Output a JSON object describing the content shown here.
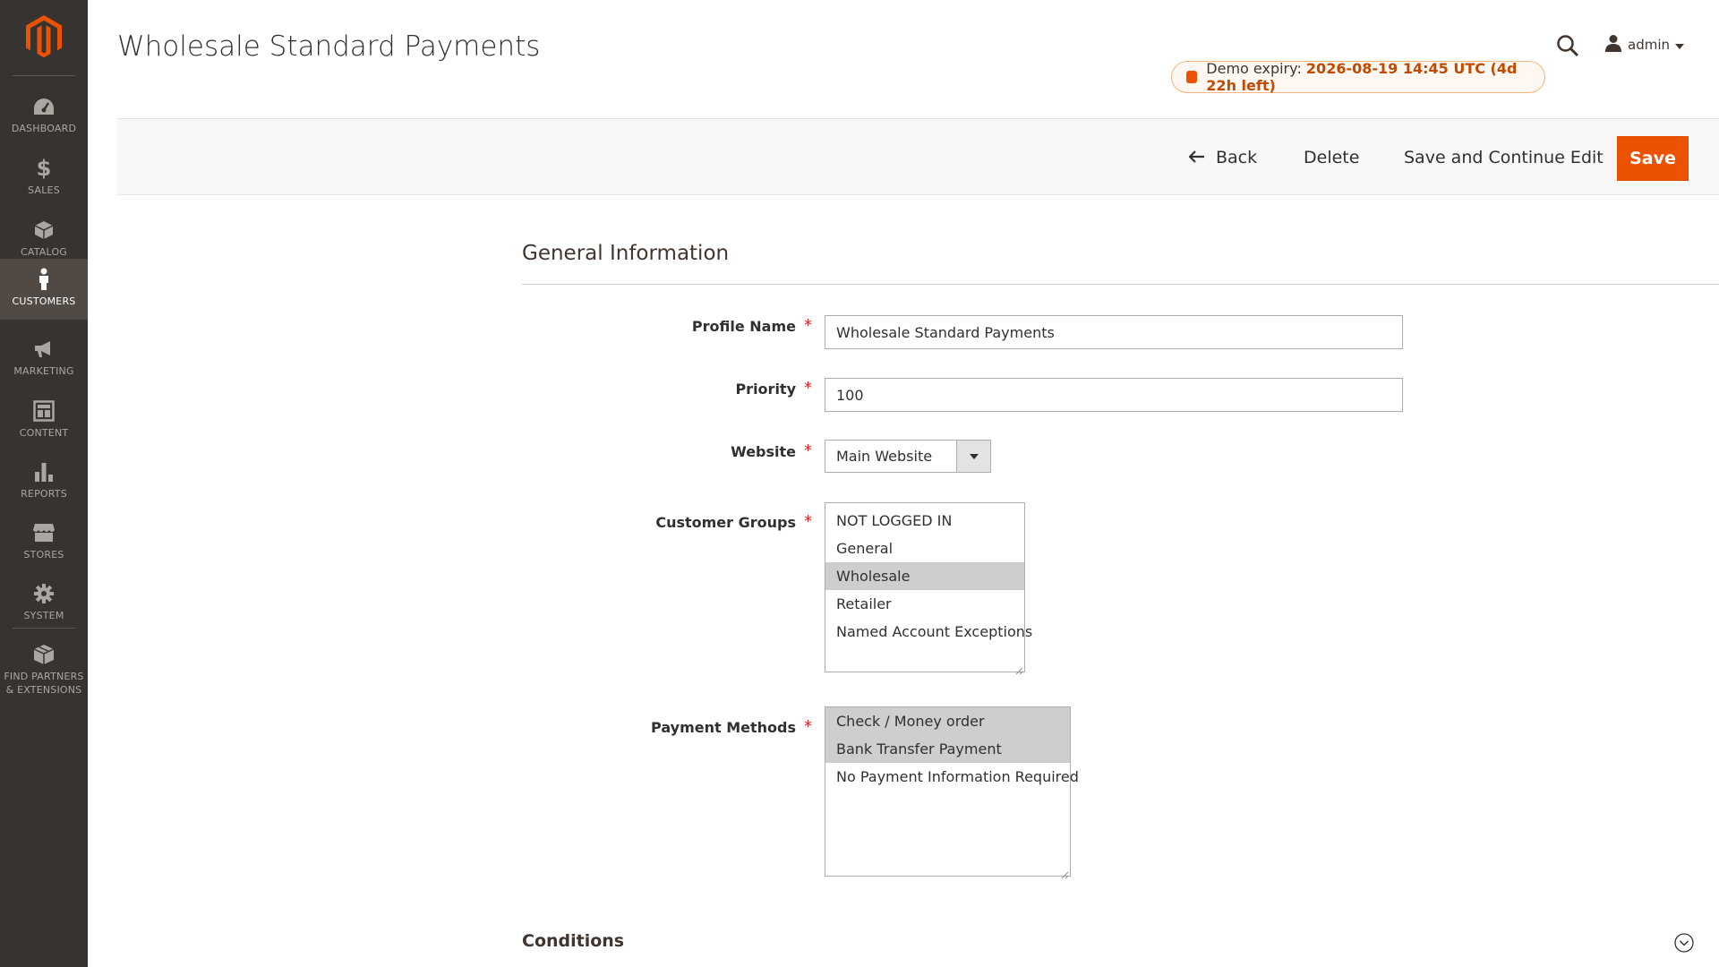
{
  "sidebar": {
    "logo": "magento-logo",
    "items": [
      {
        "label": "DASHBOARD",
        "icon": "dashboard-icon"
      },
      {
        "label": "SALES",
        "icon": "dollar-icon"
      },
      {
        "label": "CATALOG",
        "icon": "box-icon"
      },
      {
        "label": "CUSTOMERS",
        "icon": "person-icon",
        "active": true
      },
      {
        "label": "MARKETING",
        "icon": "megaphone-icon"
      },
      {
        "label": "CONTENT",
        "icon": "layout-icon"
      },
      {
        "label": "REPORTS",
        "icon": "bar-chart-icon"
      },
      {
        "label": "STORES",
        "icon": "store-icon"
      },
      {
        "label": "SYSTEM",
        "icon": "gear-icon"
      },
      {
        "label_line1": "FIND PARTNERS",
        "label_line2": "& EXTENSIONS",
        "icon": "cube-icon"
      }
    ]
  },
  "header": {
    "title": "Wholesale Standard Payments",
    "user": "admin",
    "demo": {
      "prefix": "Demo expiry:",
      "value": "2026-08-19 14:45 UTC (4d 22h left)"
    }
  },
  "actions": {
    "back": "Back",
    "delete": "Delete",
    "save_continue": "Save and Continue Edit",
    "save": "Save"
  },
  "form": {
    "section_title": "General Information",
    "profile_name": {
      "label": "Profile Name",
      "value": "Wholesale Standard Payments"
    },
    "priority": {
      "label": "Priority",
      "value": "100"
    },
    "website": {
      "label": "Website",
      "value": "Main Website"
    },
    "customer_groups": {
      "label": "Customer Groups",
      "options": [
        "NOT LOGGED IN",
        "General",
        "Wholesale",
        "Retailer",
        "Named Account Exceptions"
      ],
      "selected": [
        "Wholesale"
      ]
    },
    "payment_methods": {
      "label": "Payment Methods",
      "options": [
        "Check / Money order",
        "Bank Transfer Payment",
        "No Payment Information Required"
      ],
      "selected": [
        "Check / Money order",
        "Bank Transfer Payment"
      ]
    },
    "required_mark": "*"
  },
  "conditions": {
    "title": "Conditions"
  },
  "colors": {
    "sidebar_bg": "#373330",
    "sidebar_active": "#514943",
    "accent": "#eb5202",
    "required": "#e22626"
  }
}
